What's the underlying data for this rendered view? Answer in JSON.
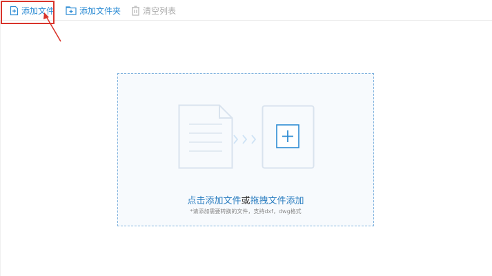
{
  "toolbar": {
    "add_file_label": "添加文件",
    "add_folder_label": "添加文件夹",
    "clear_list_label": "清空列表"
  },
  "dropzone": {
    "click_add_link": "点击添加文件",
    "or_text": "或",
    "drag_add_link": "拖拽文件添加",
    "hint": "*请添加需要转换的文件，支持dxf，dwg格式"
  },
  "icons": {
    "add_file": "file-plus-icon",
    "add_folder": "folder-plus-icon",
    "clear_list": "trash-icon",
    "document": "document-icon",
    "chevrons": "chevrons-right-icon",
    "add_target": "plus-box-icon"
  },
  "colors": {
    "accent": "#2d8cd4",
    "disabled": "#a8a8a8",
    "highlight": "#d9342b",
    "illustration": "#d9e3ee"
  }
}
